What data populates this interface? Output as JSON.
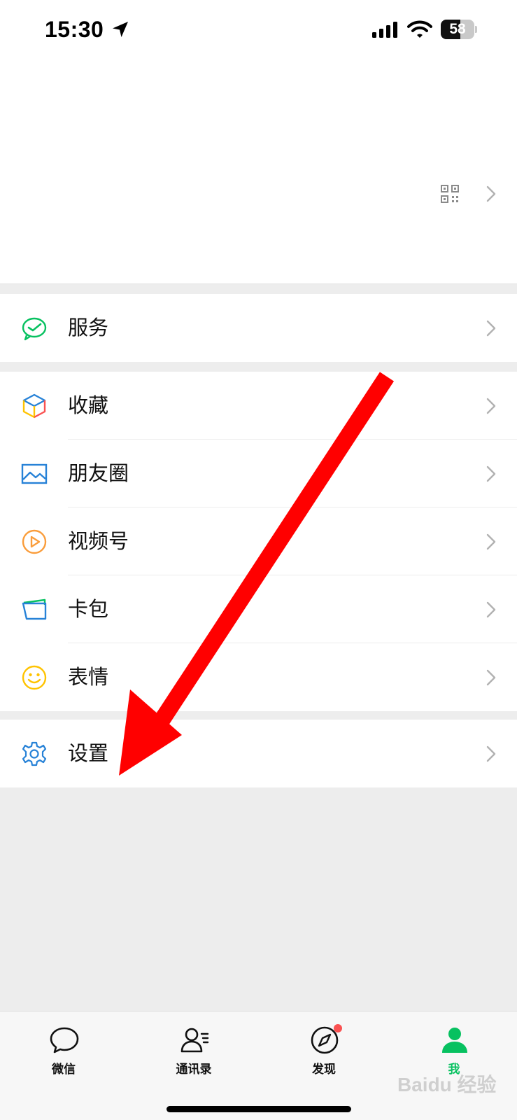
{
  "status_bar": {
    "time": "15:30",
    "battery_percent": "58",
    "battery_level": 0.58,
    "icons": [
      "location-arrow-icon",
      "cellular-signal-icon",
      "wifi-icon",
      "battery-icon"
    ]
  },
  "profile_header": {
    "icons": [
      "qr-code-icon",
      "chevron-right-icon"
    ]
  },
  "menu": {
    "groups": [
      {
        "items": [
          {
            "label": "服务",
            "icon": "service-icon",
            "icon_color": "#07c160"
          }
        ]
      },
      {
        "items": [
          {
            "label": "收藏",
            "icon": "favorites-cube-icon",
            "icon_color": "#fa9d3b"
          },
          {
            "label": "朋友圈",
            "icon": "moments-image-icon",
            "icon_color": "#2782d7"
          },
          {
            "label": "视频号",
            "icon": "channels-play-icon",
            "icon_color": "#fa9d3b"
          },
          {
            "label": "卡包",
            "icon": "cards-wallet-icon",
            "icon_color": "#2782d7"
          },
          {
            "label": "表情",
            "icon": "sticker-smile-icon",
            "icon_color": "#ffc300"
          }
        ]
      },
      {
        "items": [
          {
            "label": "设置",
            "icon": "settings-gear-icon",
            "icon_color": "#2782d7"
          }
        ]
      }
    ]
  },
  "annotation": {
    "color": "#ff0000",
    "icon": "red-arrow-icon"
  },
  "tab_bar": {
    "tabs": [
      {
        "label": "微信",
        "icon": "chat-bubble-icon",
        "active": false
      },
      {
        "label": "通讯录",
        "icon": "contacts-icon",
        "active": false
      },
      {
        "label": "发现",
        "icon": "discover-compass-icon",
        "active": false,
        "badge": true
      },
      {
        "label": "我",
        "icon": "me-person-icon",
        "active": true
      }
    ],
    "active_color": "#07c160",
    "badge_color": "#fa5151"
  },
  "watermark": {
    "text": "Baidu 经验"
  }
}
